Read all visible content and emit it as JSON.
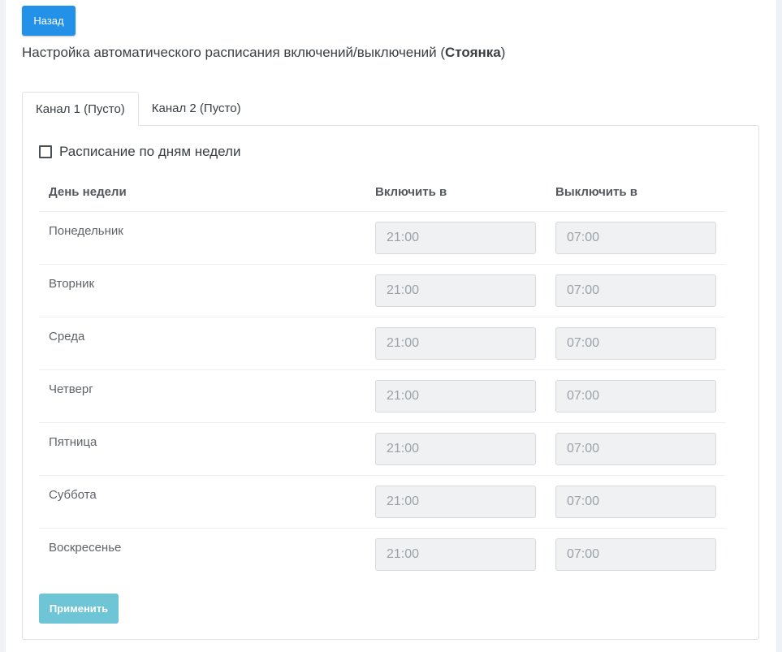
{
  "header": {
    "back_label": "Назад",
    "title_prefix": "Настройка автоматического расписания включений/выключений (",
    "title_name": "Стоянка",
    "title_suffix": ")"
  },
  "tabs": [
    {
      "label": "Канал 1 (Пусто)",
      "active": true
    },
    {
      "label": "Канал 2 (Пусто)",
      "active": false
    }
  ],
  "schedule": {
    "weekly_label": "Расписание по дням недели",
    "weekly_checked": false,
    "columns": {
      "day": "День недели",
      "on": "Включить в",
      "off": "Выключить в"
    },
    "rows": [
      {
        "day": "Понедельник",
        "on": "21:00",
        "off": "07:00"
      },
      {
        "day": "Вторник",
        "on": "21:00",
        "off": "07:00"
      },
      {
        "day": "Среда",
        "on": "21:00",
        "off": "07:00"
      },
      {
        "day": "Четверг",
        "on": "21:00",
        "off": "07:00"
      },
      {
        "day": "Пятница",
        "on": "21:00",
        "off": "07:00"
      },
      {
        "day": "Суббота",
        "on": "21:00",
        "off": "07:00"
      },
      {
        "day": "Воскресенье",
        "on": "21:00",
        "off": "07:00"
      }
    ],
    "apply_label": "Применить"
  },
  "colors": {
    "primary": "#2491e8",
    "apply": "#6ec5d6",
    "disabled_input_bg": "#eff1f3"
  }
}
